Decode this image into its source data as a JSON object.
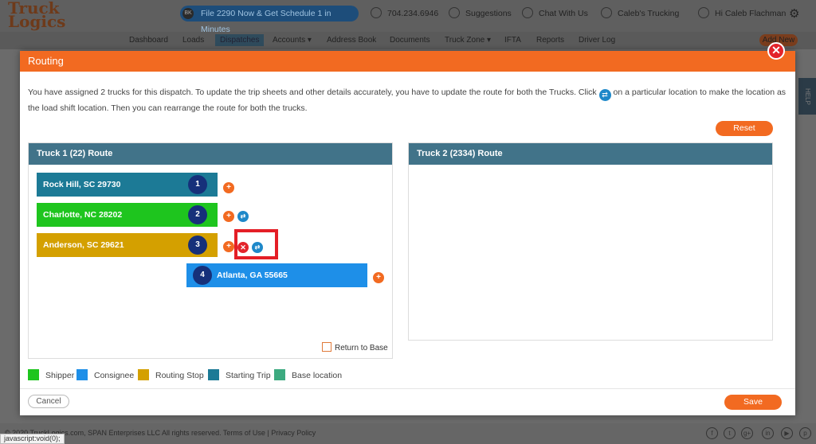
{
  "background": {
    "logo": "Truck Logics",
    "promo_icon": "BK",
    "promo": "File 2290 Now & Get Schedule 1 in Minutes",
    "phone": "704.234.6946",
    "suggestions": "Suggestions",
    "chat": "Chat With Us",
    "company": "Caleb's Trucking",
    "greeting": "Hi Caleb Flachman",
    "nav": [
      "Dashboard",
      "Loads",
      "Dispatches",
      "Accounts ▾",
      "Address Book",
      "Documents",
      "Truck Zone ▾",
      "IFTA",
      "Reports",
      "Driver Log"
    ],
    "add_new": "Add New",
    "help": "HELP",
    "footer": "© 2020 TruckLogics.com, SPAN Enterprises LLC All rights reserved. Terms of Use | Privacy Policy",
    "social": [
      "f",
      "t",
      "g+",
      "in",
      "▶",
      "p"
    ],
    "status_tip": "javascript:void(0);"
  },
  "modal": {
    "title": "Routing",
    "message_part1": "You have assigned 2 trucks for this dispatch. To update the trip sheets and other details accurately, you have to update the route for both the Trucks. Click",
    "message_part2": "on a particular location to make the location as the load shift location. Then you can rearrange the route for both the trucks.",
    "reset": "Reset",
    "truck1": {
      "title": "Truck 1 (22) Route",
      "stops": [
        {
          "label": "Rock Hill, SC 29730",
          "num": "1",
          "type": "Starting Trip",
          "color": "#1c7a96"
        },
        {
          "label": "Charlotte, NC 28202",
          "num": "2",
          "type": "Shipper",
          "color": "#1ec51e"
        },
        {
          "label": "Anderson, SC 29621",
          "num": "3",
          "type": "Routing Stop",
          "color": "#d4a000"
        },
        {
          "label": "Atlanta, GA 55665",
          "num": "4",
          "type": "Consignee",
          "color": "#1e8fe8"
        }
      ],
      "return_to_base": "Return to Base"
    },
    "truck2": {
      "title": "Truck 2 (2334) Route"
    },
    "legend": [
      {
        "label": "Shipper",
        "color": "#1ec51e"
      },
      {
        "label": "Consignee",
        "color": "#1e8fe8"
      },
      {
        "label": "Routing Stop",
        "color": "#d4a000"
      },
      {
        "label": "Starting Trip",
        "color": "#1c7a96"
      },
      {
        "label": "Base location",
        "color": "#3daa80"
      }
    ],
    "cancel": "Cancel",
    "save": "Save",
    "close": "✕"
  }
}
